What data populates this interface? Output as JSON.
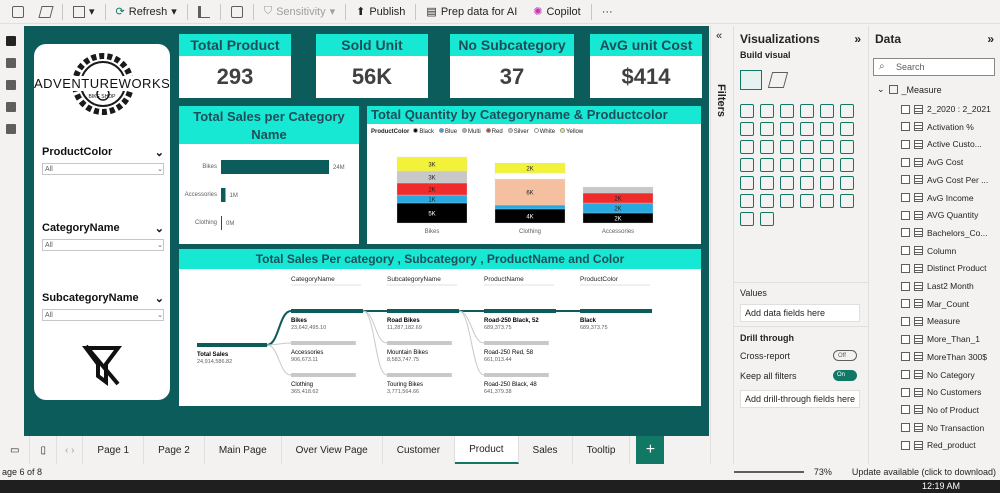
{
  "ribbon": {
    "refresh": "Refresh",
    "sensitivity": "Sensitivity",
    "publish": "Publish",
    "prep": "Prep data for AI",
    "copilot": "Copilot",
    "more": "···"
  },
  "kpis": [
    {
      "title": "Total Product",
      "value": "293"
    },
    {
      "title": "Sold Unit",
      "value": "56K"
    },
    {
      "title": "No Subcategory",
      "value": "37"
    },
    {
      "title": "AvG unit Cost",
      "value": "$414"
    }
  ],
  "logo_text": "ADVENTUREWORKS",
  "logo_sub": "BIKE SHOP",
  "slicers": [
    {
      "title": "ProductColor",
      "value": "All"
    },
    {
      "title": "CategoryName",
      "value": "All"
    },
    {
      "title": "SubcategoryName",
      "value": "All"
    }
  ],
  "bar_chart": {
    "title": "Total Sales per Category Name",
    "chart_data": {
      "type": "bar",
      "categories": [
        "Bikes",
        "Accessories",
        "Clothing"
      ],
      "values": [
        24,
        1,
        0
      ],
      "labels": [
        "24M",
        "1M",
        "0M"
      ]
    }
  },
  "stacked_chart": {
    "title": "Total Quantity by Categoryname & Productcolor",
    "legend_title": "ProductColor",
    "legend": [
      {
        "name": "Black",
        "color": "#000000"
      },
      {
        "name": "Blue",
        "color": "#28a9e0"
      },
      {
        "name": "Multi",
        "color": "#b0b0b0"
      },
      {
        "name": "Red",
        "color": "#ef2b2b"
      },
      {
        "name": "Silver",
        "color": "#c8c8c8"
      },
      {
        "name": "White",
        "color": "#ffffff"
      },
      {
        "name": "Yellow",
        "color": "#f2f23a"
      }
    ],
    "categories": [
      "Bikes",
      "Clothing",
      "Accessories"
    ],
    "segments": [
      [
        {
          "color": "#000000",
          "label": "5K"
        },
        {
          "color": "#28a9e0",
          "label": "1K"
        },
        {
          "color": "#ef2b2b",
          "label": "2K"
        },
        {
          "color": "#c8c8c8",
          "label": "3K"
        },
        {
          "color": "#f2f23a",
          "label": "3K"
        }
      ],
      [
        {
          "color": "#000000",
          "label": "4K"
        },
        {
          "color": "#28a9e0",
          "label": ""
        },
        {
          "color": "#f5c0a0",
          "label": "6K"
        },
        {
          "color": "#ffffff",
          "label": ""
        },
        {
          "color": "#f2f23a",
          "label": "2K"
        }
      ],
      [
        {
          "color": "#000000",
          "label": "2K"
        },
        {
          "color": "#28a9e0",
          "label": "2K"
        },
        {
          "color": "#ef2b2b",
          "label": "2K"
        },
        {
          "color": "#c8c8c8",
          "label": ""
        }
      ]
    ]
  },
  "decomp": {
    "title": "Total Sales Per category , Subcategory , ProductName and Color",
    "columns": [
      "CategoryName",
      "SubcategoryName",
      "ProductName",
      "ProductColor"
    ],
    "root": {
      "label": "Total Sales",
      "value": "24,914,586.82"
    },
    "col1": [
      {
        "label": "Bikes",
        "value": "23,642,495.10"
      },
      {
        "label": "Accessories",
        "value": "906,673.11"
      },
      {
        "label": "Clothing",
        "value": "365,418.62"
      }
    ],
    "col2": [
      {
        "label": "Road Bikes",
        "value": "11,287,182.69"
      },
      {
        "label": "Mountain Bikes",
        "value": "8,583,747.75"
      },
      {
        "label": "Touring Bikes",
        "value": "3,771,564.66"
      }
    ],
    "col3": [
      {
        "label": "Road-250 Black, 52",
        "value": "689,373.75"
      },
      {
        "label": "Road-250 Red, 58",
        "value": "661,013.44"
      },
      {
        "label": "Road-250 Black, 48",
        "value": "641,379.38"
      }
    ],
    "col4": [
      {
        "label": "Black",
        "value": "689,373.75"
      }
    ]
  },
  "tabs": [
    "Page 1",
    "Page 2",
    "Main Page",
    "Over View Page",
    "Customer",
    "Product",
    "Sales",
    "Tooltip"
  ],
  "active_tab": "Product",
  "status": {
    "page": "age 6 of 8",
    "zoom": "73%",
    "update": "Update available (click to download)"
  },
  "filters_label": "Filters",
  "viz": {
    "title": "Visualizations",
    "build": "Build visual",
    "values": "Values",
    "values_well": "Add data fields here",
    "drill": "Drill through",
    "cross": "Cross-report",
    "cross_state": "Off",
    "keep": "Keep all filters",
    "keep_state": "On",
    "drill_well": "Add drill-through fields here"
  },
  "data_pane": {
    "title": "Data",
    "search_placeholder": "Search",
    "table": "_Measure",
    "fields": [
      "2_2020 : 2_2021",
      "Activation %",
      "Active Custo...",
      "AvG Cost",
      "AvG Cost Per ...",
      "AvG Income",
      "AVG Quantity",
      "Bachelors_Co...",
      "Column",
      "Distinct Product",
      "Last2 Month",
      "Mar_Count",
      "Measure",
      "More_Than_1",
      "MoreThan 300$",
      "No Category",
      "No Customers",
      "No of Product",
      "No Transaction",
      "Red_product"
    ]
  },
  "time": "12:19 AM"
}
